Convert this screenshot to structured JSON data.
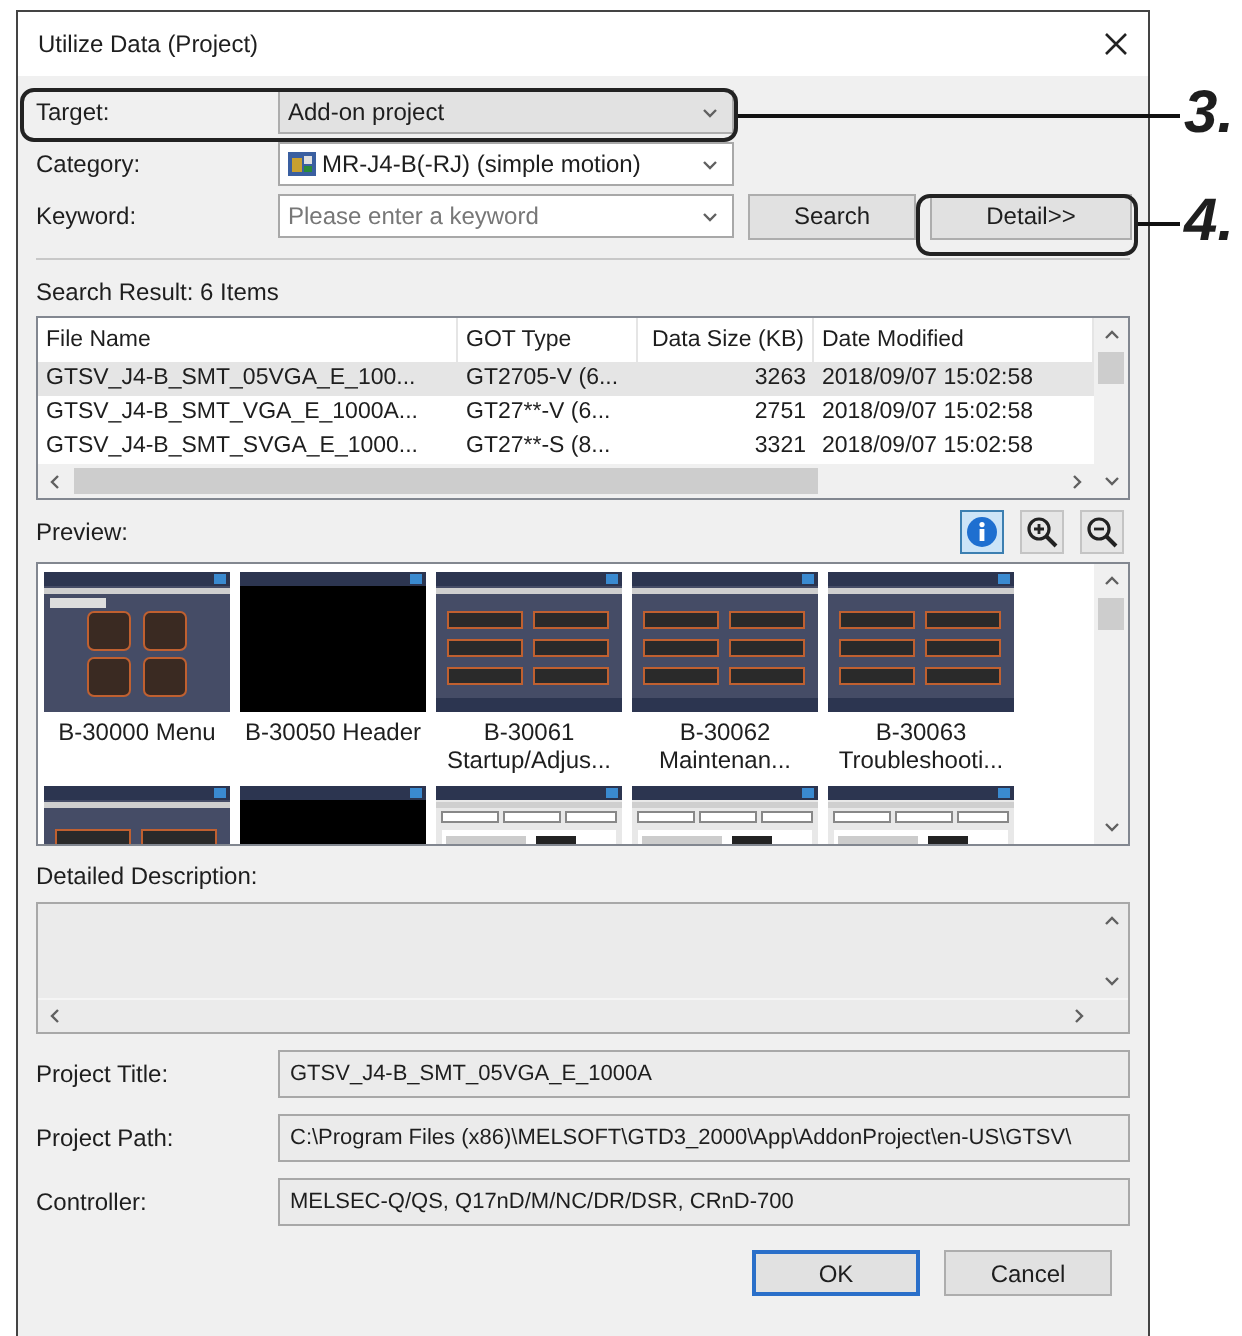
{
  "window": {
    "title": "Utilize Data (Project)"
  },
  "fields": [
    {
      "label": "Target:",
      "kind": "select",
      "value": "Add-on project"
    },
    {
      "label": "Category:",
      "kind": "icon-select",
      "value": "MR-J4-B(-RJ) (simple motion)"
    },
    {
      "label": "Keyword:",
      "kind": "combo",
      "placeholder": "Please enter a keyword"
    }
  ],
  "buttons_top": [
    {
      "label": "Search"
    },
    {
      "label": "Detail>>"
    }
  ],
  "search_result": "Search Result: 6 Items",
  "table": {
    "columns": [
      "File Name",
      "GOT Type",
      "Data Size (KB)",
      "Date Modified"
    ],
    "rows": [
      {
        "cells": [
          "GTSV_J4-B_SMT_05VGA_E_100...",
          "GT2705-V (6...",
          "3263",
          "2018/09/07 15:02:58"
        ],
        "selected": true
      },
      {
        "cells": [
          "GTSV_J4-B_SMT_VGA_E_1000A...",
          "GT27**-V (6...",
          "2751",
          "2018/09/07 15:02:58"
        ],
        "selected": false
      },
      {
        "cells": [
          "GTSV_J4-B_SMT_SVGA_E_1000...",
          "GT27**-S (8...",
          "3321",
          "2018/09/07 15:02:58"
        ],
        "selected": false
      }
    ]
  },
  "preview": {
    "label": "Preview:",
    "tools": [
      {
        "kind": "info",
        "selected": true
      },
      {
        "kind": "zoom-in",
        "selected": false
      },
      {
        "kind": "zoom-out",
        "selected": false
      }
    ],
    "thumbnails": [
      {
        "kind": "picture",
        "caption": "B-30000 Menu"
      },
      {
        "kind": "picture",
        "caption": "B-30050 Header"
      },
      {
        "kind": "picture",
        "caption": "B-30061 Startup/Adjus..."
      },
      {
        "kind": "picture",
        "caption": "B-30062 Maintenan..."
      },
      {
        "kind": "picture",
        "caption": "B-30063 Troubleshooti..."
      },
      {
        "kind": "picture"
      },
      {
        "kind": "picture"
      },
      {
        "kind": "picture"
      },
      {
        "kind": "picture"
      },
      {
        "kind": "picture"
      }
    ]
  },
  "description": {
    "label": "Detailed Description:"
  },
  "info": [
    {
      "label": "Project Title:",
      "value": "GTSV_J4-B_SMT_05VGA_E_1000A"
    },
    {
      "label": "Project Path:",
      "value": "C:\\Program Files (x86)\\MELSOFT\\GTD3_2000\\App\\AddonProject\\en-US\\GTSV\\"
    },
    {
      "label": "Controller:",
      "value": "MELSEC-Q/QS, Q17nD/M/NC/DR/DSR, CRnD-700"
    }
  ],
  "buttons": [
    {
      "label": "OK",
      "default": true
    },
    {
      "label": "Cancel",
      "default": false
    }
  ],
  "callouts": [
    {
      "label": "3."
    },
    {
      "label": "4."
    }
  ]
}
